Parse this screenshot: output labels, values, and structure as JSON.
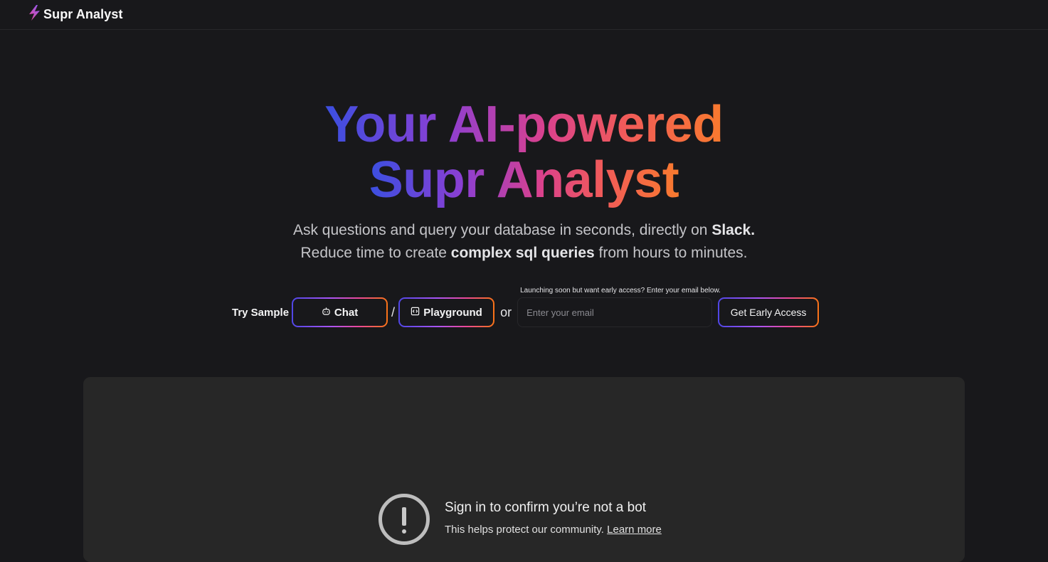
{
  "navbar": {
    "brand_name": "Supr Analyst",
    "logo_icon": "lightning-bolt-icon"
  },
  "hero": {
    "title_line1": "Your AI-powered",
    "title_line2": "Supr Analyst",
    "gradient_colors": [
      "#3b4fe0",
      "#8b3fd3",
      "#d9418e",
      "#f05a5a",
      "#f97a2e"
    ],
    "subtitle_line1_prefix": "Ask questions and query your database in seconds, directly on ",
    "subtitle_line1_bold": "Slack.",
    "subtitle_line2_prefix": "Reduce time to create ",
    "subtitle_line2_bold": "complex sql queries",
    "subtitle_line2_suffix": " from hours to minutes."
  },
  "cta": {
    "try_label": "Try Sample",
    "chat_label": "Chat",
    "chat_icon": "robot-icon",
    "separator": "/",
    "playground_label": "Playground",
    "playground_icon": "code-window-icon",
    "or_label": "or",
    "email_hint": "Launching soon but want early access? Enter your email below.",
    "email_placeholder": "Enter your email",
    "email_value": "",
    "early_access_label": "Get Early Access"
  },
  "video_embed": {
    "warning_icon": "exclamation-circle-icon",
    "title": "Sign in to confirm you’re not a bot",
    "subtitle": "This helps protect our community.",
    "learn_more": "Learn more"
  }
}
